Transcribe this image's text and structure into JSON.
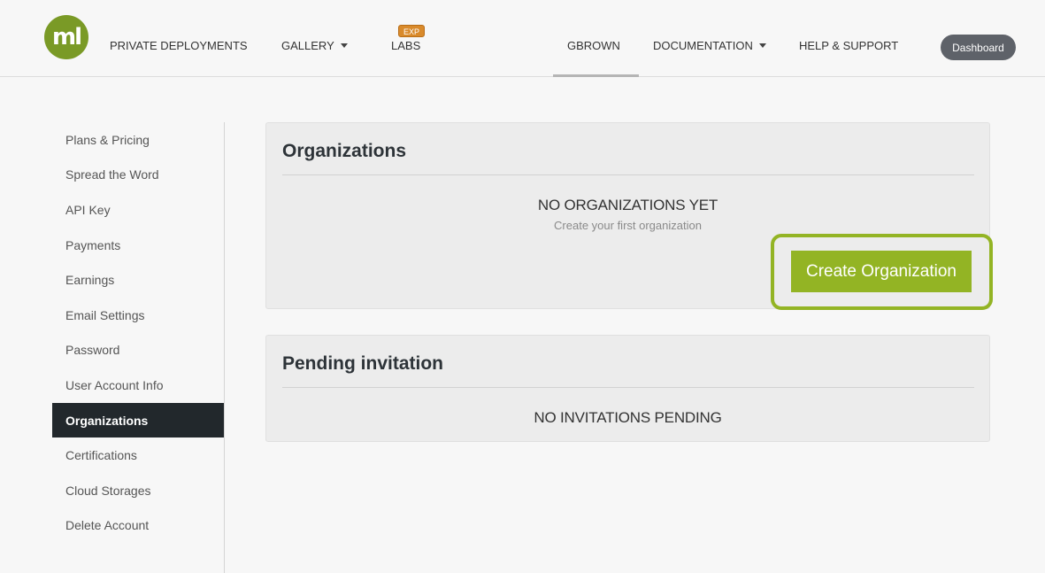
{
  "header": {
    "logo_text": "ml",
    "nav_left": [
      {
        "label": "PRIVATE DEPLOYMENTS"
      },
      {
        "label": "GALLERY"
      },
      {
        "label": "LABS",
        "badge": "EXP"
      }
    ],
    "nav_right": [
      {
        "label": "GBROWN"
      },
      {
        "label": "DOCUMENTATION"
      },
      {
        "label": "HELP & SUPPORT"
      }
    ],
    "dashboard_label": "Dashboard"
  },
  "sidebar": {
    "items": [
      {
        "label": "Plans & Pricing"
      },
      {
        "label": "Spread the Word"
      },
      {
        "label": "API Key"
      },
      {
        "label": "Payments"
      },
      {
        "label": "Earnings"
      },
      {
        "label": "Email Settings"
      },
      {
        "label": "Password"
      },
      {
        "label": "User Account Info"
      },
      {
        "label": "Organizations"
      },
      {
        "label": "Certifications"
      },
      {
        "label": "Cloud Storages"
      },
      {
        "label": "Delete Account"
      }
    ],
    "active_index": 8
  },
  "organizations": {
    "title": "Organizations",
    "empty_heading": "NO ORGANIZATIONS YET",
    "empty_subtext": "Create your first organization",
    "create_button": "Create Organization"
  },
  "invitations": {
    "title": "Pending invitation",
    "empty_heading": "NO INVITATIONS PENDING"
  },
  "colors": {
    "brand_green": "#93b424",
    "logo_green": "#7a9a26",
    "sidebar_active_bg": "#22282c",
    "badge_orange": "#d98a2b"
  }
}
